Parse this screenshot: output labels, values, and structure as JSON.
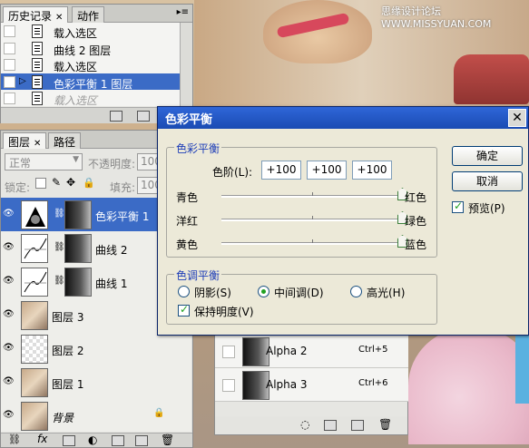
{
  "watermark": "思缘设计论坛 WWW.MISSYUAN.COM",
  "history": {
    "tabs": [
      "历史记录",
      "动作"
    ],
    "items": [
      {
        "label": "载入选区",
        "selected": false,
        "ghost": false
      },
      {
        "label": "曲线 2 图层",
        "selected": false,
        "ghost": false
      },
      {
        "label": "载入选区",
        "selected": false,
        "ghost": false
      },
      {
        "label": "色彩平衡 1 图层",
        "selected": true,
        "ghost": false
      },
      {
        "label": "载入选区",
        "selected": false,
        "ghost": true
      }
    ]
  },
  "layers": {
    "tabs": [
      "图层",
      "路径"
    ],
    "blend_mode": "正常",
    "opacity_label": "不透明度:",
    "opacity_value": "100",
    "lock_label": "锁定:",
    "fill_label": "填充:",
    "fill_value": "100",
    "items": [
      {
        "name": "色彩平衡 1",
        "type": "balance",
        "selected": true
      },
      {
        "name": "曲线 2",
        "type": "curves",
        "selected": false
      },
      {
        "name": "曲线 1",
        "type": "curves",
        "selected": false
      },
      {
        "name": "图层 3",
        "type": "photo",
        "selected": false
      },
      {
        "name": "图层 2",
        "type": "empty",
        "selected": false
      },
      {
        "name": "图层 1",
        "type": "photo",
        "selected": false
      },
      {
        "name": "背景",
        "type": "photo",
        "selected": false,
        "italic": true
      }
    ]
  },
  "channels": {
    "items": [
      {
        "name": "Alpha 2",
        "shortcut": "Ctrl+5"
      },
      {
        "name": "Alpha 3",
        "shortcut": "Ctrl+6"
      }
    ]
  },
  "dialog": {
    "title": "色彩平衡",
    "balance_group": "色彩平衡",
    "levels_label": "色阶(L):",
    "levels": [
      "+100",
      "+100",
      "+100"
    ],
    "sliders": [
      {
        "left": "青色",
        "right": "红色",
        "value": 100
      },
      {
        "left": "洋红",
        "right": "绿色",
        "value": 100
      },
      {
        "left": "黄色",
        "right": "蓝色",
        "value": 100
      }
    ],
    "tone_group": "色调平衡",
    "tones": [
      {
        "label": "阴影(S)",
        "on": false
      },
      {
        "label": "中间调(D)",
        "on": true
      },
      {
        "label": "高光(H)",
        "on": false
      }
    ],
    "preserve_label": "保持明度(V)",
    "preserve_checked": true,
    "ok_label": "确定",
    "cancel_label": "取消",
    "preview_label": "预览(P)",
    "preview_checked": true,
    "colors": {
      "title_bar": "#2f66d8",
      "accent": "#1c3cb7",
      "selection": "#3b6bc6"
    }
  }
}
